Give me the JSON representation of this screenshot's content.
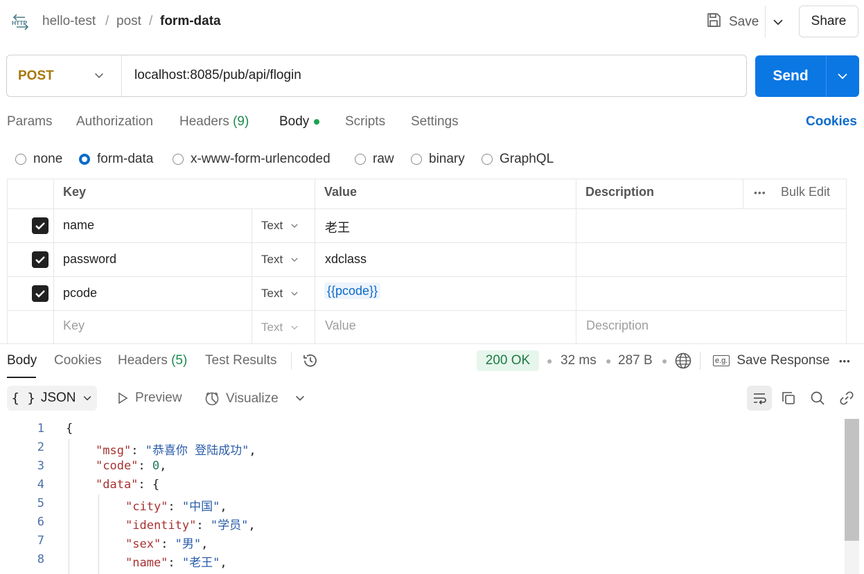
{
  "header": {
    "logo_text": "HTTP",
    "breadcrumb": [
      "hello-test",
      "post",
      "form-data"
    ],
    "breadcrumb_sep": "/",
    "save_label": "Save",
    "share_label": "Share"
  },
  "request": {
    "method": "POST",
    "url": "localhost:8085/pub/api/flogin",
    "send_label": "Send"
  },
  "request_tabs": [
    {
      "label": "Params"
    },
    {
      "label": "Authorization"
    },
    {
      "label": "Headers",
      "count": "(9)"
    },
    {
      "label": "Body",
      "active": true
    },
    {
      "label": "Scripts"
    },
    {
      "label": "Settings"
    }
  ],
  "cookies_label": "Cookies",
  "body_types": [
    "none",
    "form-data",
    "x-www-form-urlencoded",
    "raw",
    "binary",
    "GraphQL"
  ],
  "body_type_selected": "form-data",
  "table": {
    "headers": {
      "key": "Key",
      "value": "Value",
      "description": "Description",
      "bulk_edit": "Bulk Edit"
    },
    "rows": [
      {
        "checked": true,
        "key": "name",
        "type": "Text",
        "value": "老王"
      },
      {
        "checked": true,
        "key": "password",
        "type": "Text",
        "value": "xdclass"
      },
      {
        "checked": true,
        "key": "pcode",
        "type": "Text",
        "value": "{{pcode}}"
      }
    ],
    "placeholder": {
      "key": "Key",
      "type": "Text",
      "value": "Value",
      "description": "Description"
    }
  },
  "response": {
    "tabs": [
      {
        "label": "Body",
        "active": true
      },
      {
        "label": "Cookies"
      },
      {
        "label": "Headers",
        "count": "(5)"
      },
      {
        "label": "Test Results"
      }
    ],
    "status": "200 OK",
    "time": "32 ms",
    "size": "287 B",
    "save_response_label": "Save Response",
    "format_label": "JSON",
    "preview_label": "Preview",
    "visualize_label": "Visualize",
    "eg_badge": "e.g.",
    "lines": [
      {
        "num": "1",
        "text": "{"
      },
      {
        "num": "2",
        "key": "\"msg\"",
        "value": "\"恭喜你 登陆成功\"",
        "tail": ","
      },
      {
        "num": "3",
        "key": "\"code\"",
        "value": "0",
        "tail": ","
      },
      {
        "num": "4",
        "key": "\"data\"",
        "value": "{",
        "tail": ""
      },
      {
        "num": "5",
        "key": "\"city\"",
        "value": "\"中国\"",
        "tail": ","
      },
      {
        "num": "6",
        "key": "\"identity\"",
        "value": "\"学员\"",
        "tail": ","
      },
      {
        "num": "7",
        "key": "\"sex\"",
        "value": "\"男\"",
        "tail": ","
      },
      {
        "num": "8",
        "key": "\"name\"",
        "value": "\"老王\"",
        "tail": ","
      }
    ]
  },
  "colors": {
    "accent": "#0b77e3",
    "method": "#a8770a",
    "status_ok_bg": "#e6f6ec",
    "status_ok_text": "#1e7a45"
  }
}
